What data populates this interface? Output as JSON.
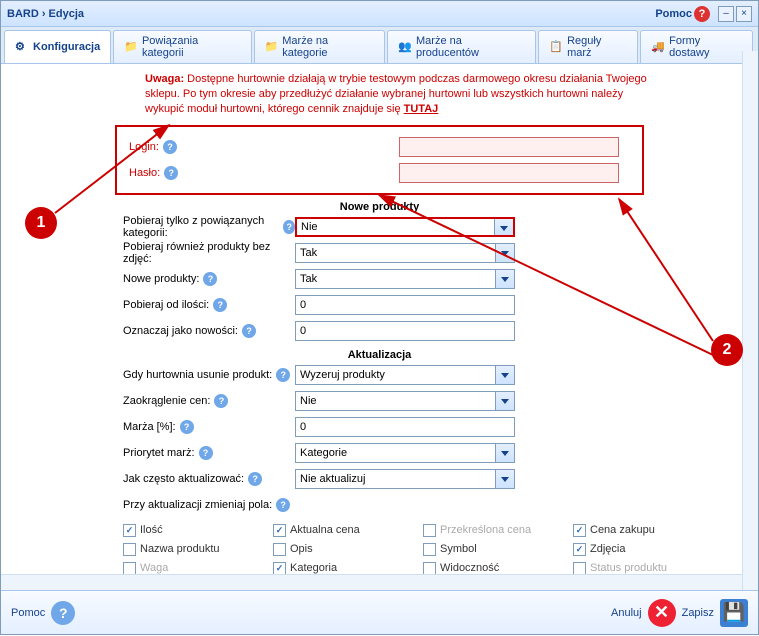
{
  "title": "BARD › Edycja",
  "help_label": "Pomoc",
  "tabs": [
    {
      "label": "Konfiguracja"
    },
    {
      "label": "Powiązania kategorii"
    },
    {
      "label": "Marże na kategorie"
    },
    {
      "label": "Marże na producentów"
    },
    {
      "label": "Reguły marż"
    },
    {
      "label": "Formy dostawy"
    }
  ],
  "warning": {
    "prefix": "Uwaga:",
    "text": " Dostępne hurtownie działają w trybie testowym podczas darmowego okresu działania Twojego sklepu. Po tym okresie aby przedłużyć działanie wybranej hurtowni lub wszystkich hurtowni należy wykupić moduł hurtowni, którego cennik znajduje się ",
    "link": "TUTAJ"
  },
  "login": {
    "label": "Login:",
    "value": ""
  },
  "haslo": {
    "label": "Hasło:",
    "value": ""
  },
  "section_nowe": "Nowe produkty",
  "pobieraj_kat": {
    "label": "Pobieraj tylko z powiązanych kategorii:",
    "value": "Nie"
  },
  "pobieraj_zdj": {
    "label": "Pobieraj również produkty bez zdjęć:",
    "value": "Tak"
  },
  "nowe_prod": {
    "label": "Nowe produkty:",
    "value": "Tak"
  },
  "pobieraj_od": {
    "label": "Pobieraj od ilości:",
    "value": "0"
  },
  "oznaczaj": {
    "label": "Oznaczaj jako nowości:",
    "value": "0"
  },
  "section_akt": "Aktualizacja",
  "gdy_usunie": {
    "label": "Gdy hurtownia usunie produkt:",
    "value": "Wyzeruj produkty"
  },
  "zaokraglenie": {
    "label": "Zaokrąglenie cen:",
    "value": "Nie"
  },
  "marza": {
    "label": "Marża [%]:",
    "value": "0"
  },
  "priorytet": {
    "label": "Priorytet marż:",
    "value": "Kategorie"
  },
  "jak_czesto": {
    "label": "Jak często aktualizować:",
    "value": "Nie aktualizuj"
  },
  "przy_akt": "Przy aktualizacji zmieniaj pola:",
  "checks": [
    {
      "label": "Ilość",
      "checked": true,
      "disabled": false
    },
    {
      "label": "Aktualna cena",
      "checked": true,
      "disabled": false
    },
    {
      "label": "Przekreślona cena",
      "checked": false,
      "disabled": true
    },
    {
      "label": "Cena zakupu",
      "checked": true,
      "disabled": false
    },
    {
      "label": "Nazwa produktu",
      "checked": false,
      "disabled": false
    },
    {
      "label": "Opis",
      "checked": false,
      "disabled": false
    },
    {
      "label": "Symbol",
      "checked": false,
      "disabled": false
    },
    {
      "label": "Zdjęcia",
      "checked": true,
      "disabled": false
    },
    {
      "label": "Waga",
      "checked": false,
      "disabled": true
    },
    {
      "label": "Kategoria",
      "checked": true,
      "disabled": false
    },
    {
      "label": "Widoczność",
      "checked": false,
      "disabled": false
    },
    {
      "label": "Status produktu",
      "checked": false,
      "disabled": true
    }
  ],
  "footer": {
    "help": "Pomoc",
    "cancel": "Anuluj",
    "save": "Zapisz"
  },
  "annotations": {
    "one": "1",
    "two": "2"
  }
}
